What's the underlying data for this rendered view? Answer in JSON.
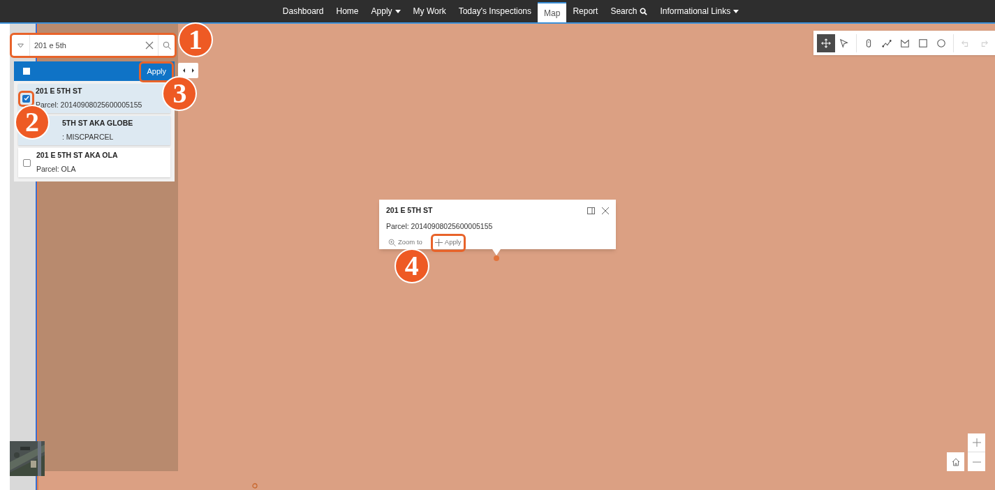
{
  "nav": [
    {
      "label": "Dashboard",
      "selected": false,
      "kind": "plain"
    },
    {
      "label": "Home",
      "selected": false,
      "kind": "plain"
    },
    {
      "label": "Apply",
      "selected": false,
      "kind": "dropdown"
    },
    {
      "label": "My Work",
      "selected": false,
      "kind": "plain"
    },
    {
      "label": "Today's Inspections",
      "selected": false,
      "kind": "plain"
    },
    {
      "label": "Map",
      "selected": true,
      "kind": "plain"
    },
    {
      "label": "Report",
      "selected": false,
      "kind": "plain"
    },
    {
      "label": "Search",
      "selected": false,
      "kind": "search"
    },
    {
      "label": "Informational Links",
      "selected": false,
      "kind": "dropdown"
    }
  ],
  "search": {
    "value": "201 e 5th",
    "callout": "1"
  },
  "results": {
    "select_all_checked": false,
    "apply_button": {
      "label": "Apply",
      "callout": "3"
    },
    "rows": [
      {
        "title": "201 E 5TH ST",
        "subtitle": "Parcel: 20140908025600005155",
        "highlighted": true,
        "checked": true,
        "callout": "2"
      },
      {
        "title": "5TH ST AKA GLOBE",
        "subtitle": ": MISCPARCEL",
        "highlighted": true
      },
      {
        "title": "201 E 5TH ST AKA OLA",
        "subtitle": "Parcel: OLA",
        "highlighted": false,
        "checked": false
      }
    ]
  },
  "tools": [
    {
      "kind": "pan",
      "selected": true,
      "disabled": false
    },
    {
      "kind": "select",
      "selected": false,
      "disabled": false
    },
    {
      "kind": "point",
      "selected": false,
      "disabled": false
    },
    {
      "kind": "polyline",
      "selected": false,
      "disabled": false
    },
    {
      "kind": "polygon",
      "selected": false,
      "disabled": false
    },
    {
      "kind": "rectangle",
      "selected": false,
      "disabled": false
    },
    {
      "kind": "circle",
      "selected": false,
      "disabled": false
    },
    {
      "kind": "undo",
      "selected": false,
      "disabled": true
    },
    {
      "kind": "redo",
      "selected": false,
      "disabled": true
    }
  ],
  "popup": {
    "title": "201 E 5TH ST",
    "subtitle": "Parcel: 20140908025600005155",
    "actions": [
      {
        "kind": "zoom",
        "label": "Zoom to"
      },
      {
        "kind": "add",
        "label": "Apply",
        "callout": "4"
      }
    ]
  }
}
